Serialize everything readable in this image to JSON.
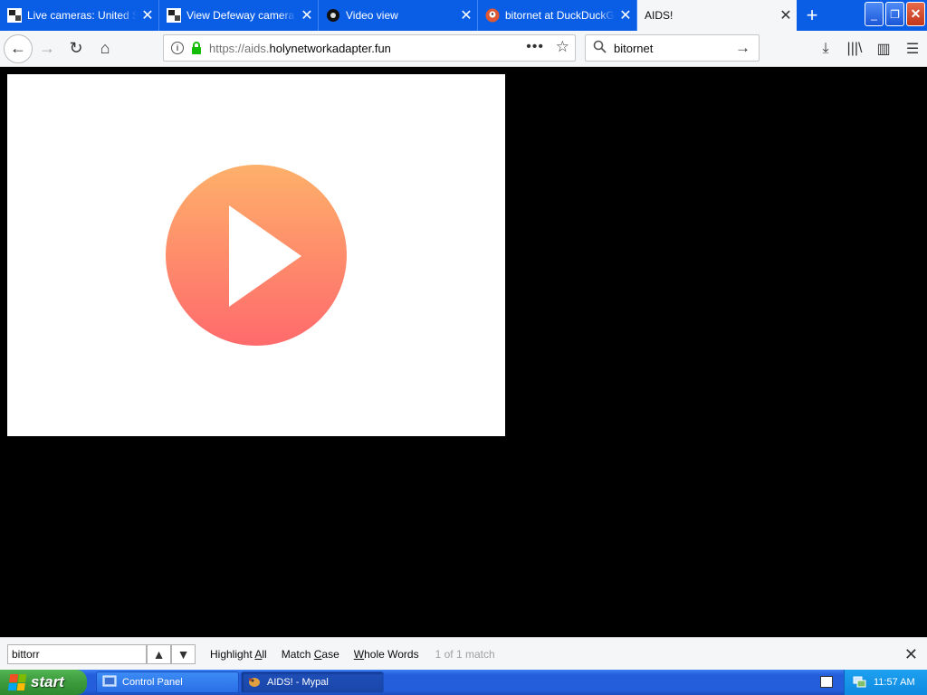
{
  "tabs": [
    {
      "title": "Live cameras: United States",
      "icon": "camera-favicon",
      "close": "✕"
    },
    {
      "title": "View Defeway camera in",
      "icon": "camera-favicon",
      "close": "✕"
    },
    {
      "title": "Video view",
      "icon": "eye-favicon",
      "close": "✕"
    },
    {
      "title": "bitornet at DuckDuckGo",
      "icon": "duckduckgo-favicon",
      "close": "✕"
    },
    {
      "title": "AIDS!",
      "icon": "",
      "close": "✕"
    }
  ],
  "new_tab": "+",
  "window_buttons": {
    "minimize": "_",
    "restore": "❐",
    "close": "✕"
  },
  "nav": {
    "back": "←",
    "forward": "→",
    "reload": "↻",
    "home": "⌂"
  },
  "url": {
    "prefix": "https://aids.",
    "domain": "holynetworkadapter.fun",
    "info": "i",
    "more": "•••",
    "bookmark": "☆"
  },
  "search": {
    "value": "bitornet",
    "go": "→"
  },
  "toolbar": {
    "download": "⤓",
    "library": "|||\\",
    "sidebar": "▥",
    "menu": "☰"
  },
  "find": {
    "value": "bittorr",
    "prev": "▲",
    "next": "▼",
    "highlight_pre": "Highlight ",
    "highlight_key": "A",
    "highlight_post": "ll",
    "case_pre": "Match ",
    "case_key": "C",
    "case_post": "ase",
    "whole_key": "W",
    "whole_post": "hole Words",
    "status": "1 of 1 match",
    "close": "✕"
  },
  "taskbar": {
    "start_label": "start",
    "items": [
      {
        "label": "Control Panel"
      },
      {
        "label": "AIDS! - Mypal"
      }
    ],
    "clock": "11:57 AM"
  },
  "colors": {
    "tabbar": "#0a5ee6",
    "play_top": "#fdb06a",
    "play_bottom": "#ff6a6c",
    "lock": "#12bc00"
  }
}
